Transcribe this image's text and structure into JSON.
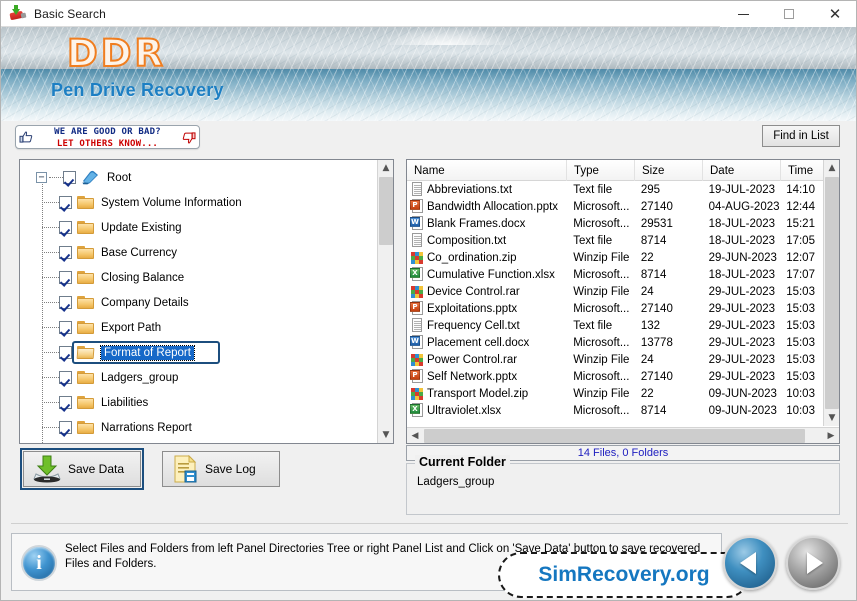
{
  "window": {
    "title": "Basic Search",
    "title_icon": "usb-drive-recovery-icon",
    "minimize_label": "—",
    "maximize_label": "□",
    "close_label": "✕"
  },
  "banner": {
    "logo": "DDR",
    "product": "Pen Drive Recovery",
    "logo_color": "#f07e20",
    "product_color": "#1d7fc3"
  },
  "toolbar": {
    "rate_line1": "WE ARE GOOD OR BAD?",
    "rate_line2": "LET OTHERS KNOW...",
    "rate_line1_color": "#102a83",
    "rate_line2_color": "#cc0000",
    "find_in_list": "Find in List"
  },
  "tree": {
    "root_label": "Root",
    "root_icon": "computer-icon",
    "expander": "−",
    "nodes": [
      {
        "label": "System Volume Information",
        "checked": true,
        "selected": false
      },
      {
        "label": "Update Existing",
        "checked": true,
        "selected": false
      },
      {
        "label": "Base Currency",
        "checked": true,
        "selected": false
      },
      {
        "label": "Closing Balance",
        "checked": true,
        "selected": false
      },
      {
        "label": "Company Details",
        "checked": true,
        "selected": false
      },
      {
        "label": "Export Path",
        "checked": true,
        "selected": false
      },
      {
        "label": "Format of Report",
        "checked": true,
        "selected": true
      },
      {
        "label": "Ladgers_group",
        "checked": true,
        "selected": false
      },
      {
        "label": "Liabilities",
        "checked": true,
        "selected": false
      },
      {
        "label": "Narrations Report",
        "checked": true,
        "selected": false
      }
    ]
  },
  "filelist": {
    "columns": [
      "Name",
      "Type",
      "Size",
      "Date",
      "Time"
    ],
    "rows": [
      {
        "name": "Abbreviations.txt",
        "icon": "txt-file-icon",
        "type": "Text file",
        "size": "295",
        "date": "19-JUL-2023",
        "time": "14:10"
      },
      {
        "name": "Bandwidth Allocation.pptx",
        "icon": "pptx-file-icon",
        "type": "Microsoft...",
        "size": "27140",
        "date": "04-AUG-2023",
        "time": "12:44"
      },
      {
        "name": "Blank Frames.docx",
        "icon": "docx-file-icon",
        "type": "Microsoft...",
        "size": "29531",
        "date": "18-JUL-2023",
        "time": "15:21"
      },
      {
        "name": "Composition.txt",
        "icon": "txt-file-icon",
        "type": "Text file",
        "size": "8714",
        "date": "18-JUL-2023",
        "time": "17:05"
      },
      {
        "name": "Co_ordination.zip",
        "icon": "zip-file-icon",
        "type": "Winzip File",
        "size": "22",
        "date": "29-JUN-2023",
        "time": "12:07"
      },
      {
        "name": "Cumulative Function.xlsx",
        "icon": "xlsx-file-icon",
        "type": "Microsoft...",
        "size": "8714",
        "date": "18-JUL-2023",
        "time": "17:07"
      },
      {
        "name": "Device Control.rar",
        "icon": "zip-file-icon",
        "type": "Winzip File",
        "size": "24",
        "date": "29-JUL-2023",
        "time": "15:03"
      },
      {
        "name": "Exploitations.pptx",
        "icon": "pptx-file-icon",
        "type": "Microsoft...",
        "size": "27140",
        "date": "29-JUL-2023",
        "time": "15:03"
      },
      {
        "name": "Frequency Cell.txt",
        "icon": "txt-file-icon",
        "type": "Text file",
        "size": "132",
        "date": "29-JUL-2023",
        "time": "15:03"
      },
      {
        "name": "Placement cell.docx",
        "icon": "docx-file-icon",
        "type": "Microsoft...",
        "size": "13778",
        "date": "29-JUL-2023",
        "time": "15:03"
      },
      {
        "name": "Power Control.rar",
        "icon": "zip-file-icon",
        "type": "Winzip File",
        "size": "24",
        "date": "29-JUL-2023",
        "time": "15:03"
      },
      {
        "name": "Self Network.pptx",
        "icon": "pptx-file-icon",
        "type": "Microsoft...",
        "size": "27140",
        "date": "29-JUL-2023",
        "time": "15:03"
      },
      {
        "name": "Transport Model.zip",
        "icon": "zip-file-icon",
        "type": "Winzip File",
        "size": "22",
        "date": "09-JUN-2023",
        "time": "10:03"
      },
      {
        "name": "Ultraviolet.xlsx",
        "icon": "xlsx-file-icon",
        "type": "Microsoft...",
        "size": "8714",
        "date": "09-JUN-2023",
        "time": "10:03"
      }
    ],
    "status": "14 Files, 0 Folders"
  },
  "actions": {
    "save_data": "Save Data",
    "save_log": "Save Log"
  },
  "current_folder": {
    "title": "Current Folder",
    "value": "Ladgers_group"
  },
  "footer": {
    "message": "Select Files and Folders from left Panel Directories Tree or right Panel List and Click on 'Save Data' button to save recovered Files and Folders.",
    "info_glyph": "i",
    "brand": "SimRecovery.org",
    "brand_color": "#1577c0",
    "back_label": "◀",
    "forward_label": "▶"
  }
}
